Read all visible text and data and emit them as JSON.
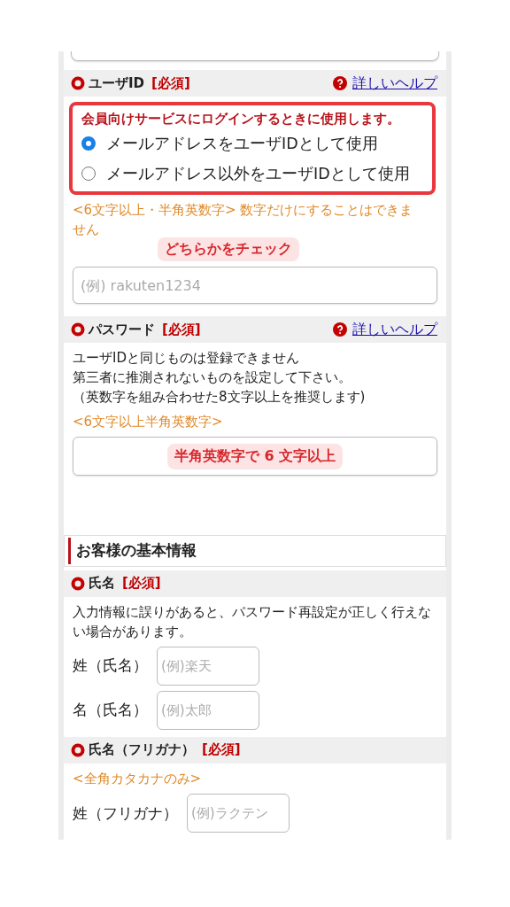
{
  "user_id": {
    "label": "ユーザID",
    "required": "[必須]",
    "help": "詳しいヘルプ",
    "callout": {
      "heading": "会員向けサービスにログインするときに使用します。",
      "options": [
        {
          "label": "メールアドレスをユーザIDとして使用",
          "selected": true
        },
        {
          "label": "メールアドレス以外をユーザIDとして使用",
          "selected": false
        }
      ]
    },
    "hint": "<6文字以上・半角英数字> 数字だけにすることはできません",
    "annotation": "どちらかをチェック",
    "field": {
      "placeholder": "(例) rakuten1234"
    }
  },
  "password": {
    "label": "パスワード",
    "required": "[必須]",
    "help": "詳しいヘルプ",
    "notes": [
      "ユーザIDと同じものは登録できません",
      "第三者に推測されないものを設定して下さい。",
      "（英数字を組み合わせた8文字以上を推奨します)"
    ],
    "hint": "<6文字以上半角英数字>",
    "field_annotation": "半角英数字で 6 文字以上"
  },
  "section_title": "お客様の基本情報",
  "name": {
    "label": "氏名",
    "required": "[必須]",
    "note": "入力情報に誤りがあると、パスワード再設定が正しく行えない場合があります。",
    "fields": [
      {
        "label": "姓（氏名）",
        "placeholder": "(例)楽天"
      },
      {
        "label": "名（氏名）",
        "placeholder": "(例)太郎"
      }
    ]
  },
  "kana": {
    "label": "氏名（フリガナ）",
    "required": "[必須]",
    "hint": "<全角カタカナのみ>",
    "fields": [
      {
        "label": "姓（フリガナ）",
        "placeholder": "(例)ラクテン"
      }
    ]
  }
}
